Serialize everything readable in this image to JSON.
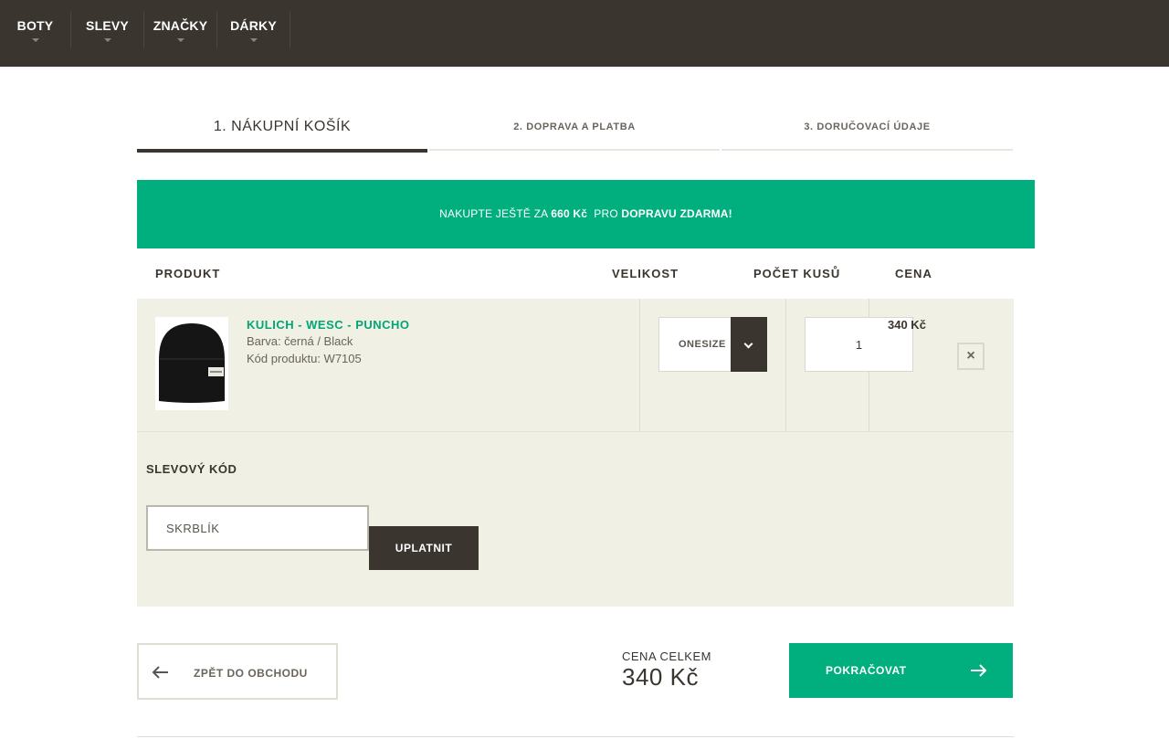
{
  "nav": {
    "items": [
      {
        "label": "BOTY"
      },
      {
        "label": "SLEVY"
      },
      {
        "label": "ZNAČKY"
      },
      {
        "label": "DÁRKY"
      }
    ]
  },
  "steps": [
    {
      "label": "1. NÁKUPNÍ KOŠÍK",
      "active": true
    },
    {
      "label": "2. DOPRAVA A PLATBA",
      "active": false
    },
    {
      "label": "3. DORUČOVACÍ ÚDAJE",
      "active": false
    }
  ],
  "promo": {
    "prefix": "NAKUPTE JEŠTĚ ZA",
    "amount": "660 Kč",
    "middle": "PRO",
    "highlight": "DOPRAVU ZDARMA!"
  },
  "table": {
    "headers": {
      "product": "PRODUKT",
      "size": "VELIKOST",
      "quantity": "POČET KUSŮ",
      "price": "CENA"
    }
  },
  "cart": {
    "items": [
      {
        "name": "KULICH - WESC - PUNCHO",
        "color": "Barva: černá / Black",
        "code": "Kód produktu: W7105",
        "size": "ONESIZE",
        "quantity": "1",
        "price": "340 Kč",
        "remove_symbol": "×",
        "image_icon": "beanie-product-image"
      }
    ]
  },
  "discount": {
    "title": "SLEVOVÝ KÓD",
    "value": "SKRBLÍK",
    "apply_label": "UPLATNIT"
  },
  "footer": {
    "back_label": "ZPĚT DO OBCHODU",
    "total_label": "CENA CELKEM",
    "total_value": "340 Kč",
    "continue_label": "POKRAČOVAT"
  },
  "colors": {
    "nav_bg": "#3a352f",
    "accent_green": "#00ae7e",
    "row_bg": "#f0f0e5"
  }
}
